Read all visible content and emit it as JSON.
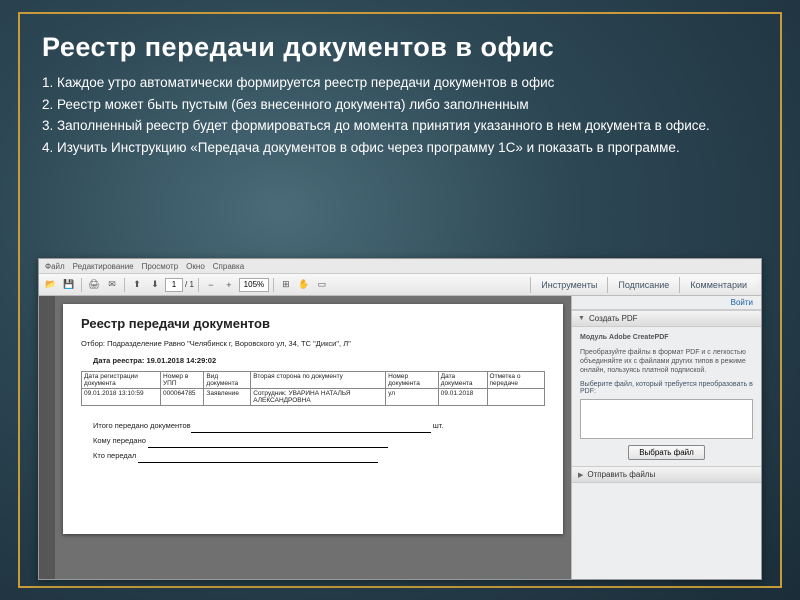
{
  "slide": {
    "title": "Реестр передачи документов в офис",
    "points": [
      "1. Каждое утро автоматически формируется реестр передачи документов  в офис",
      "2. Реестр может быть  пустым (без  внесенного документа)  либо заполненным",
      "3. Заполненный реестр будет формироваться до момента принятия указанного в нем документа в офисе.",
      "4. Изучить Инструкцию «Передача документов в офис через программу 1С» и показать в программе."
    ]
  },
  "menubar": [
    "Файл",
    "Редактирование",
    "Просмотр",
    "Окно",
    "Справка"
  ],
  "toolbar": {
    "page": "1",
    "pages": "/ 1",
    "zoom": "105%",
    "tabs": [
      "Инструменты",
      "Подписание",
      "Комментарии"
    ]
  },
  "doc": {
    "heading": "Реестр передачи документов",
    "filter_label": "Отбор:",
    "filter_value": "Подразделение Равно \"Челябинск г, Воровского ул, 34, ТС \"Дикси\", Л\"",
    "regdate_label": "Дата реестра:",
    "regdate_value": "19.01.2018 14:29:02",
    "cols": [
      "Дата регистрации документа",
      "Номер в УПП",
      "Вид документа",
      "Вторая сторона по документу",
      "Номер документа",
      "Дата документа",
      "Отметка о передаче"
    ],
    "row": [
      "09.01.2018 13:10:59",
      "000064785",
      "Заявление",
      "Сотрудник: УВАРИНА НАТАЛЬЯ АЛЕКСАНДРОВНА",
      "ул",
      "09.01.2018",
      ""
    ],
    "totals": {
      "total_label": "Итого передано документов",
      "total_unit": "шт.",
      "to_label": "Кому передано",
      "by_label": "Кто передал"
    }
  },
  "side": {
    "login": "Войти",
    "create": "Создать PDF",
    "module_title": "Модуль Adobe CreatePDF",
    "module_text": "Преобразуйте файлы в формат PDF и с легкостью объединяйте их с файлами других типов в режиме онлайн, пользуясь платной подпиской.",
    "pick_hint": "Выберите файл, который требуется преобразовать в PDF:",
    "pick_btn": "Выбрать файл",
    "send": "Отправить файлы"
  }
}
